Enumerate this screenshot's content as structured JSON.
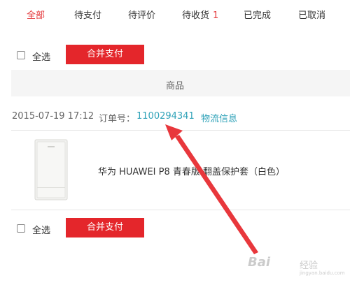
{
  "tabs": [
    {
      "label": "全部",
      "active": true
    },
    {
      "label": "待支付"
    },
    {
      "label": "待评价"
    },
    {
      "label": "待收货",
      "count": "1"
    },
    {
      "label": "已完成"
    },
    {
      "label": "已取消"
    }
  ],
  "top_bar": {
    "select_all_label": "全选",
    "merge_pay_label": "合并支付"
  },
  "table": {
    "column_header": "商品"
  },
  "order": {
    "date": "2015-07-19 17:12",
    "number_label": "订单号：",
    "number": "1100294341",
    "logistics_label": "物流信息",
    "product_name": "华为 HUAWEI P8 青春版 翻盖保护套（白色）"
  },
  "bottom_bar": {
    "select_all_label": "全选",
    "merge_pay_label": "合并支付"
  },
  "watermark": {
    "brand": "Bai",
    "sub": "经验",
    "url": "jingyan.baidu.com"
  },
  "colors": {
    "accent": "#e4393c",
    "link": "#2fa2b8",
    "button": "#e4262b"
  }
}
